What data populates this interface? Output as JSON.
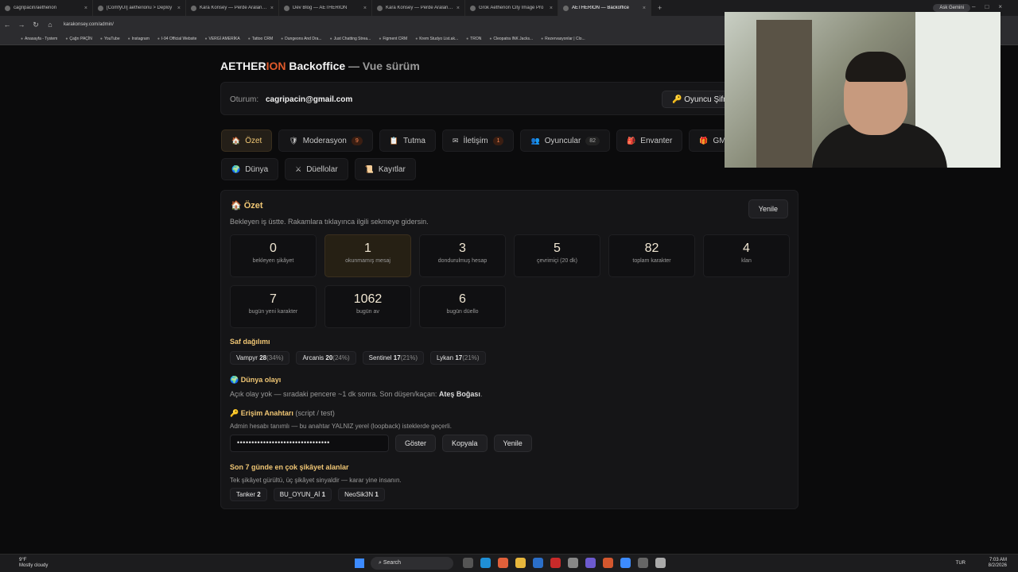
{
  "browser": {
    "tabs": [
      {
        "title": "cagripacin/aetherion"
      },
      {
        "title": "[ComfyUI] aetherionu > Deploy"
      },
      {
        "title": "Kara Konsey — Perde Aralanıyor"
      },
      {
        "title": "Dev Blog — AETHERION"
      },
      {
        "title": "Kara Konsey — Perde Aralanıyor"
      },
      {
        "title": "Grok Aetherion City Image Pro"
      },
      {
        "title": "AETHERION — Backoffice"
      }
    ],
    "active_tab": 6,
    "new_tab_symbol": "+",
    "ask_label": "Ask Gemini",
    "url": "karakonsey.com/admin/",
    "bookmarks": [
      "Anasayfa - Tystem",
      "Çağrı PAÇİN",
      "YouTube",
      "Instagram",
      "I-94 Official Website",
      "VERGİ AMERİKA",
      "Tattoo CRM",
      "Dungeons And Dra...",
      "Just Chatting Strea...",
      "Figment CRM",
      "Krem Studyo List.ak...",
      "TRON",
      "Cleopatra INK Jacks...",
      "Rezervasyonlar | Clo..."
    ]
  },
  "app": {
    "title_prefix": "AETHER",
    "title_accent": "ION",
    "title_main": " Backoffice",
    "title_sub": " — Vue sürüm",
    "accent_color": "#e05a2b"
  },
  "session": {
    "label": "Oturum:",
    "email": "cagripacin@gmail.com",
    "password_button": "🔑 Oyuncu Şifre"
  },
  "tabs_row1": [
    {
      "icon": "🏠",
      "label": "Özet",
      "badge": ""
    },
    {
      "icon": "🛡",
      "label": "Moderasyon",
      "badge": "9"
    },
    {
      "icon": "📋",
      "label": "Tutma",
      "badge": ""
    },
    {
      "icon": "✉",
      "label": "İletişim",
      "badge": "1"
    },
    {
      "icon": "👥",
      "label": "Oyuncular",
      "badge": "82"
    },
    {
      "icon": "🎒",
      "label": "Envanter",
      "badge": ""
    },
    {
      "icon": "🎁",
      "label": "GM İşlem",
      "badge": ""
    }
  ],
  "tabs_row2": [
    {
      "icon": "🌍",
      "label": "Dünya"
    },
    {
      "icon": "⚔",
      "label": "Düellolar"
    },
    {
      "icon": "📜",
      "label": "Kayıtlar"
    }
  ],
  "summary": {
    "title": "🏠 Özet",
    "refresh_label": "Yenile",
    "description": "Bekleyen iş üstte. Rakamlara tıklayınca ilgili sekmeye gidersin.",
    "stats_row1": [
      {
        "value": "0",
        "label": "bekleyen şikâyet",
        "highlight": false
      },
      {
        "value": "1",
        "label": "okunmamış mesaj",
        "highlight": true
      },
      {
        "value": "3",
        "label": "dondurulmuş hesap",
        "highlight": false
      },
      {
        "value": "5",
        "label": "çevrimiçi (20 dk)",
        "highlight": false
      },
      {
        "value": "82",
        "label": "toplam karakter",
        "highlight": false
      },
      {
        "value": "4",
        "label": "klan",
        "highlight": false
      }
    ],
    "stats_row2": [
      {
        "value": "7",
        "label": "bugün yeni karakter"
      },
      {
        "value": "1062",
        "label": "bugün av"
      },
      {
        "value": "6",
        "label": "bugün düello"
      }
    ],
    "class_title": "Saf dağılımı",
    "classes": [
      {
        "name": "Vampyr",
        "count": "28",
        "pct": "(34%)"
      },
      {
        "name": "Arcanis",
        "count": "20",
        "pct": "(24%)"
      },
      {
        "name": "Sentinel",
        "count": "17",
        "pct": "(21%)"
      },
      {
        "name": "Lykan",
        "count": "17",
        "pct": "(21%)"
      }
    ],
    "world_title": "🌍 Dünya olayı",
    "world_text": "Açık olay yok — sıradaki pencere ~1 dk sonra. Son düşen/kaçan:",
    "world_last": "Ateş Boğası",
    "world_end": ".",
    "key_title": "🔑 Erişim Anahtarı",
    "key_suffix": " (script / test)",
    "key_desc": "Admin hesabı tanımlı — bu anahtar YALNIZ yerel (loopback) isteklerde geçerli.",
    "key_masked": "••••••••••••••••••••••••••••••••",
    "key_show": "Göster",
    "key_copy": "Kopyala",
    "key_refresh": "Yenile",
    "complaints_title": "Son 7 günde en çok şikâyet alanlar",
    "complaints_desc": "Tek şikâyet gürültü, üç şikâyet sinyaldir — karar yine insanın.",
    "complaints": [
      {
        "name": "Tanker",
        "count": "2"
      },
      {
        "name": "BU_OYUN_Aİ",
        "count": "1"
      },
      {
        "name": "NeoSik3N",
        "count": "1"
      }
    ]
  },
  "taskbar": {
    "weather_temp": "9°F",
    "weather_desc": "Mostly cloudy",
    "search": "Search",
    "lang": "TUR",
    "time": "7:03 AM",
    "date": "8/2/2026"
  }
}
